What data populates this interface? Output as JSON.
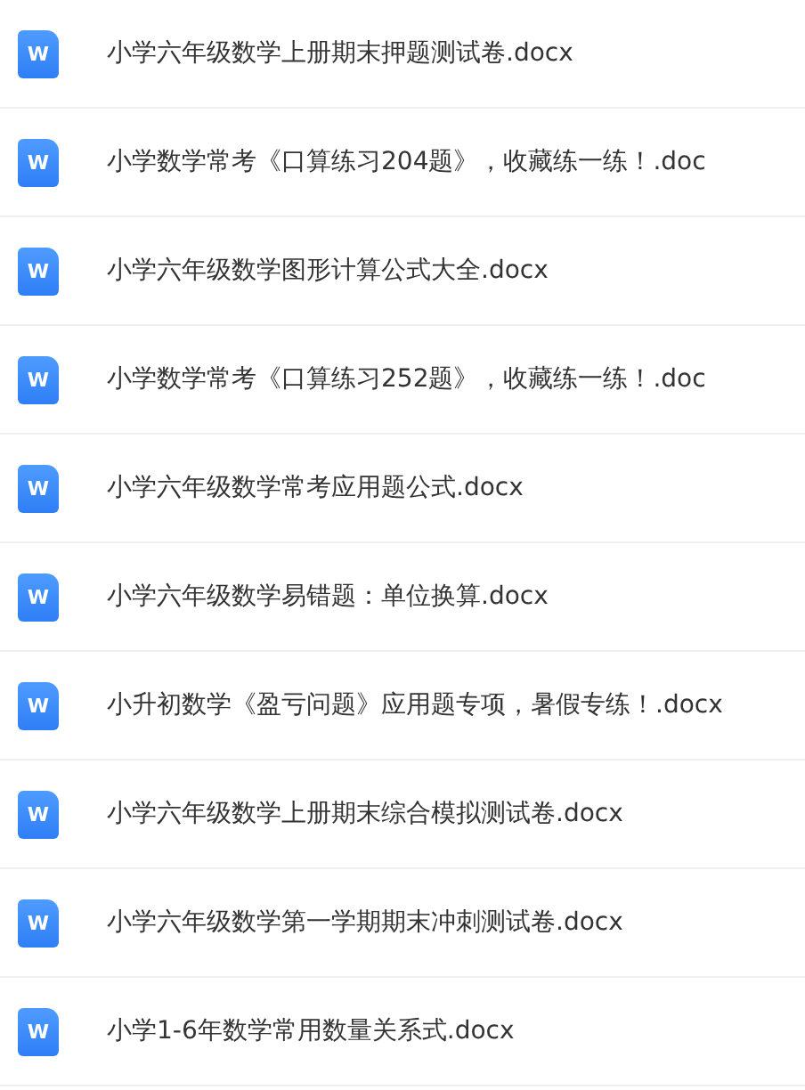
{
  "files": [
    {
      "icon_label": "W",
      "name": "小学六年级数学上册期末押题测试卷.docx"
    },
    {
      "icon_label": "W",
      "name": "小学数学常考《口算练习204题》，收藏练一练！.doc"
    },
    {
      "icon_label": "W",
      "name": "小学六年级数学图形计算公式大全.docx"
    },
    {
      "icon_label": "W",
      "name": "小学数学常考《口算练习252题》，收藏练一练！.doc"
    },
    {
      "icon_label": "W",
      "name": "小学六年级数学常考应用题公式.docx"
    },
    {
      "icon_label": "W",
      "name": "小学六年级数学易错题：单位换算.docx"
    },
    {
      "icon_label": "W",
      "name": "小升初数学《盈亏问题》应用题专项，暑假专练！.docx"
    },
    {
      "icon_label": "W",
      "name": "小学六年级数学上册期末综合模拟测试卷.docx"
    },
    {
      "icon_label": "W",
      "name": "小学六年级数学第一学期期末冲刺测试卷.docx"
    },
    {
      "icon_label": "W",
      "name": "小学1-6年数学常用数量关系式.docx"
    }
  ]
}
